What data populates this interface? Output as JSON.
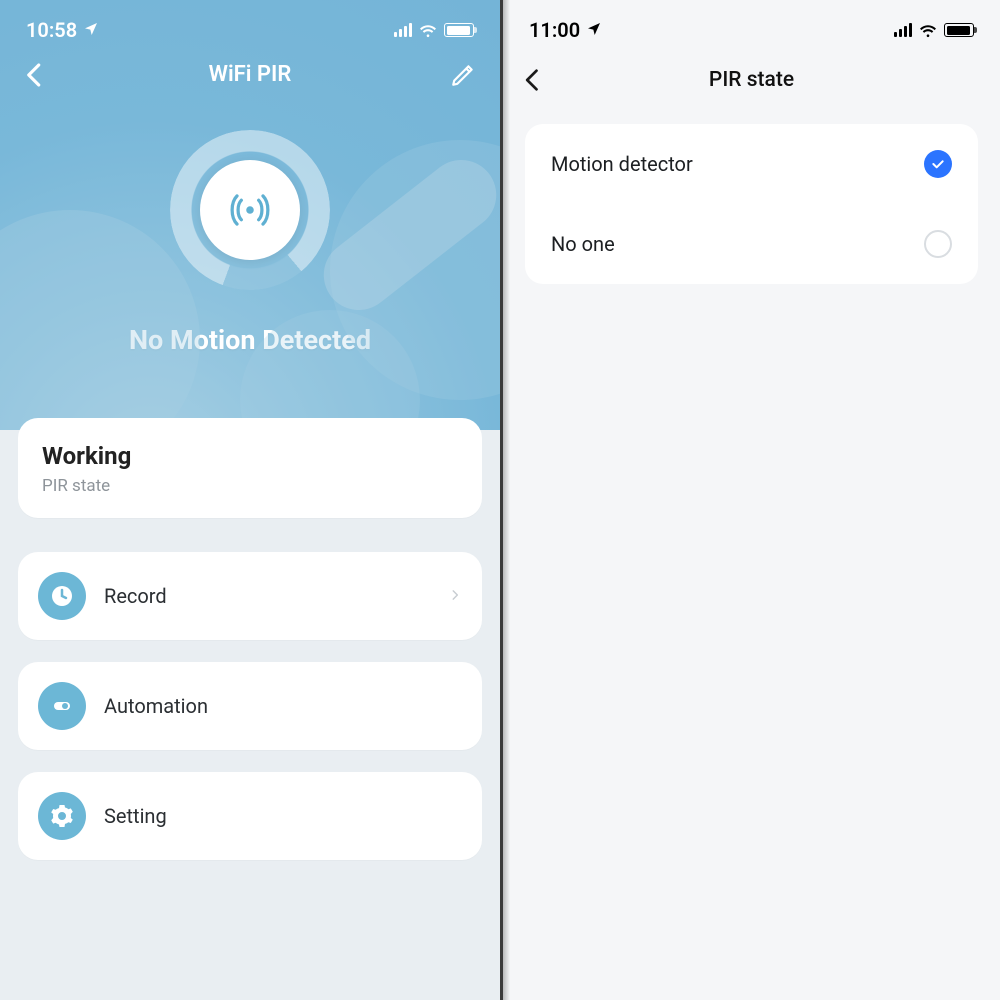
{
  "left": {
    "status": {
      "time": "10:58"
    },
    "nav_title": "WiFi PIR",
    "main_status": "No Motion Detected",
    "state_card": {
      "title": "Working",
      "subtitle": "PIR state"
    },
    "rows": {
      "record": {
        "label": "Record"
      },
      "automation": {
        "label": "Automation"
      },
      "setting": {
        "label": "Setting"
      }
    }
  },
  "right": {
    "status": {
      "time": "11:00"
    },
    "nav_title": "PIR state",
    "options": {
      "motion": {
        "label": "Motion detector",
        "selected": true
      },
      "noone": {
        "label": "No one",
        "selected": false
      }
    }
  }
}
